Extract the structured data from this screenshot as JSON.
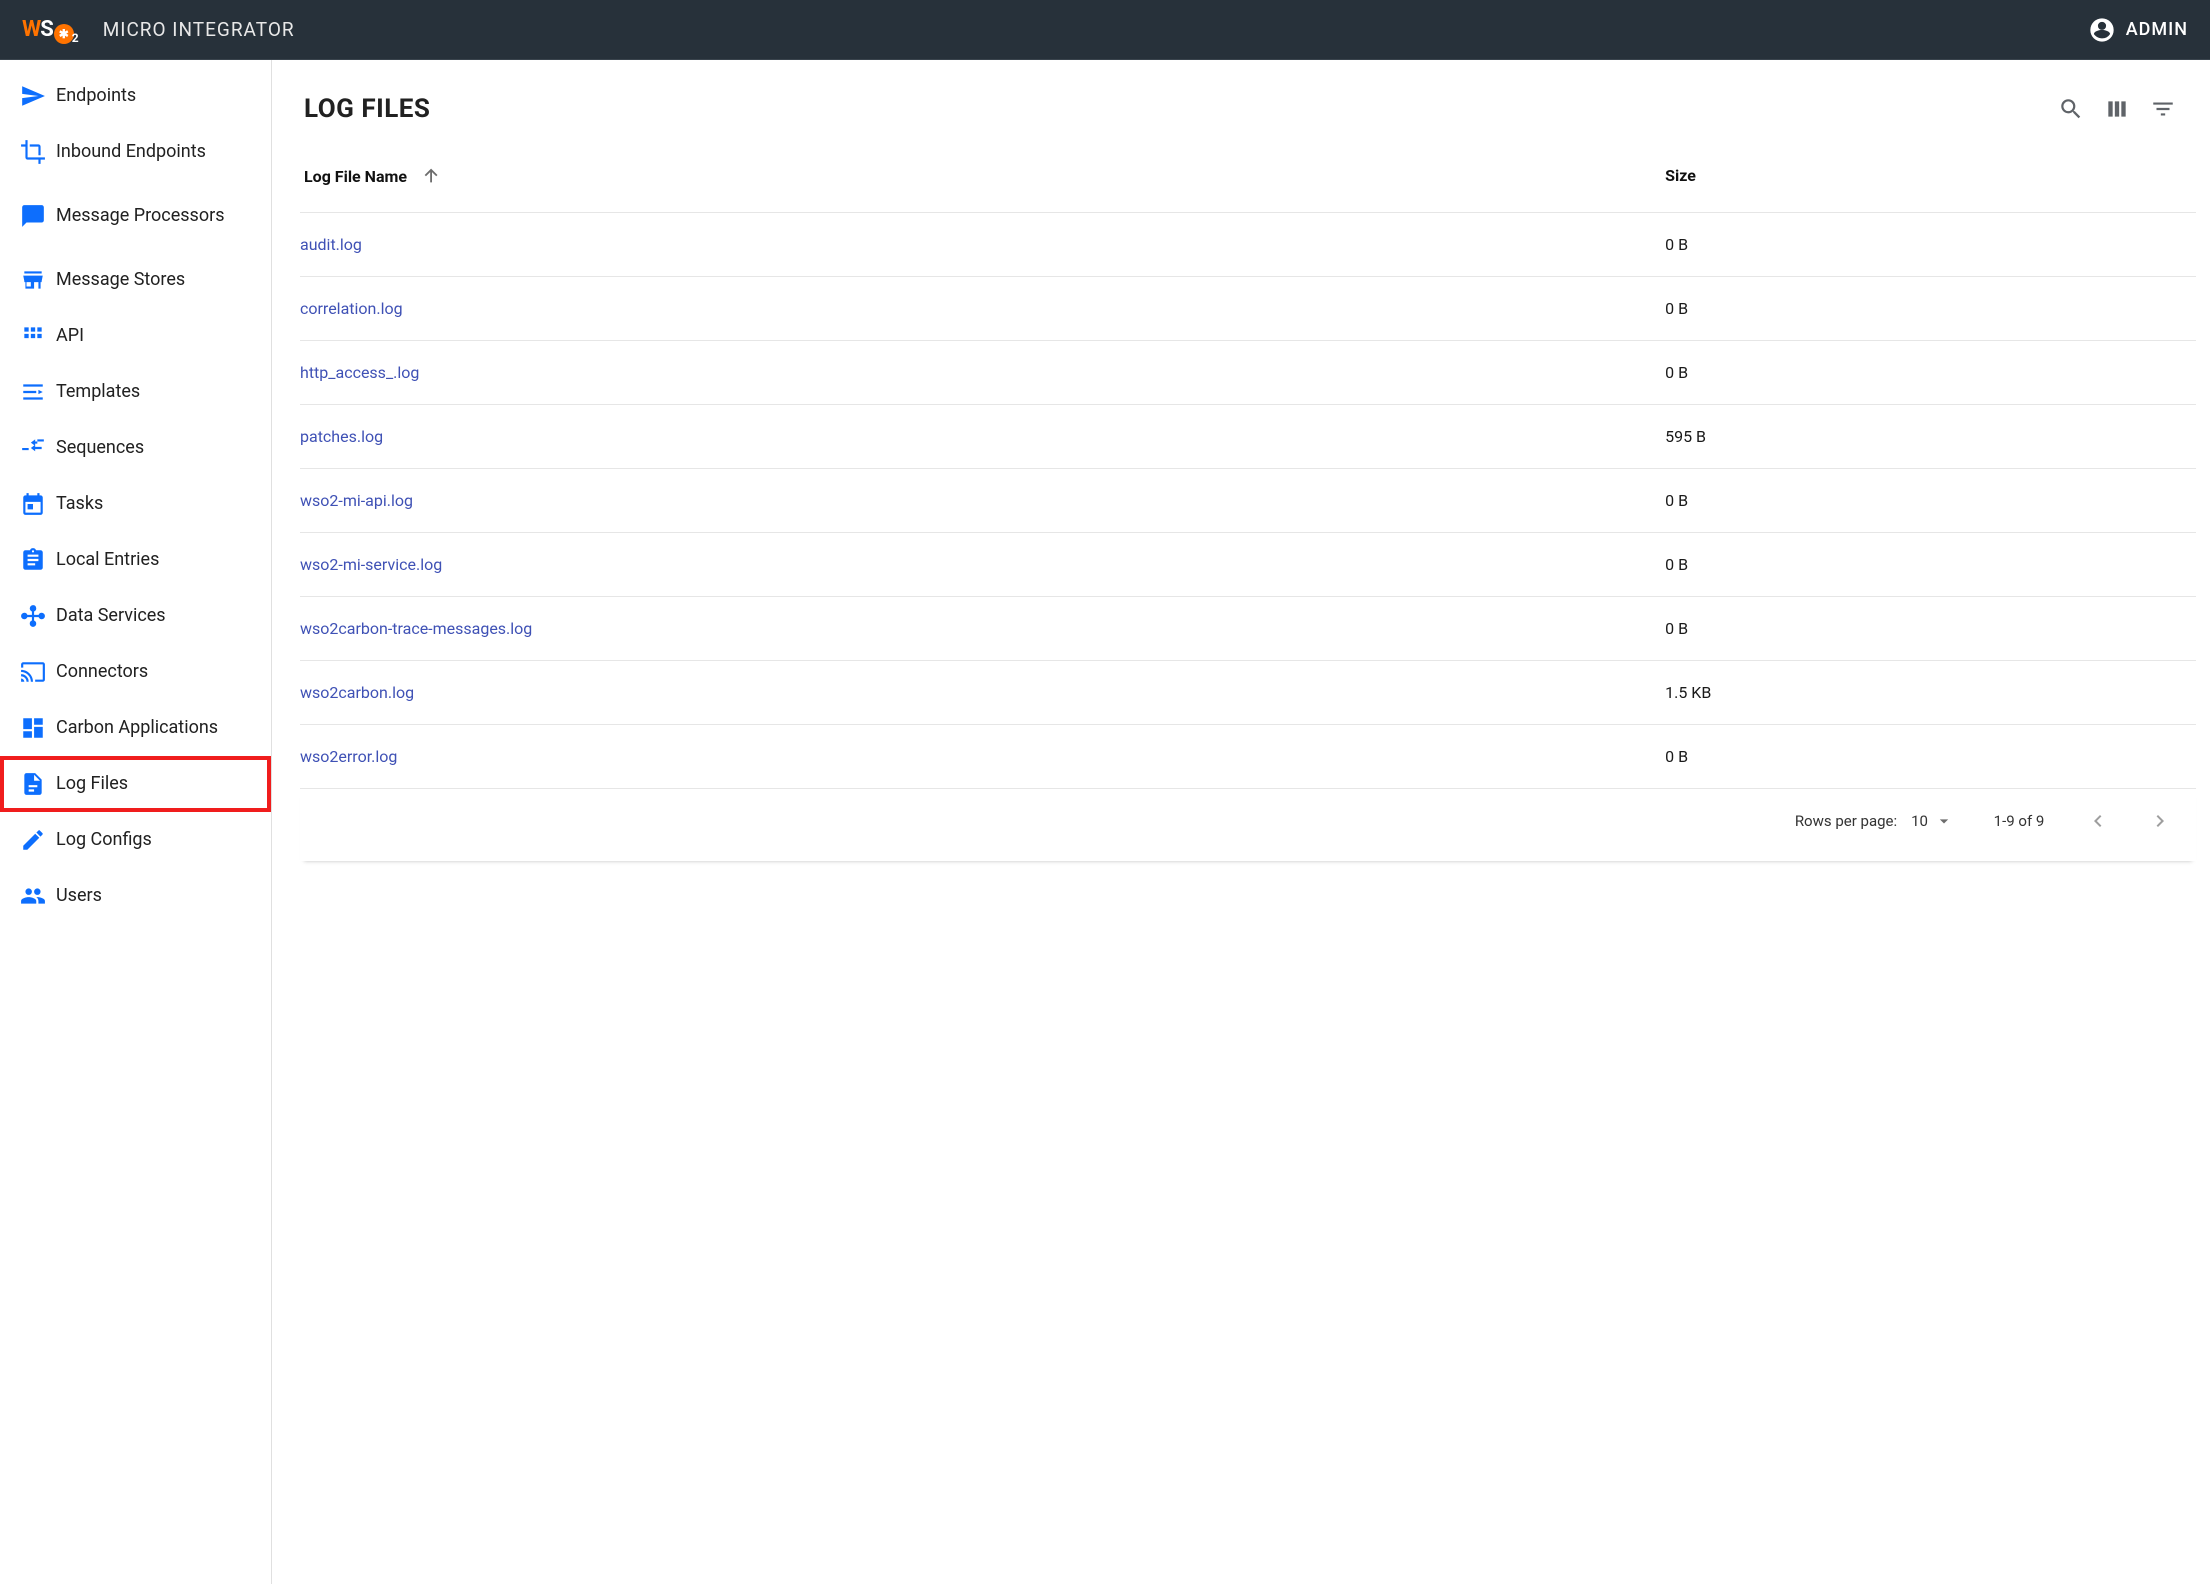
{
  "header": {
    "app_title": "MICRO INTEGRATOR",
    "user_label": "ADMIN"
  },
  "sidebar": {
    "items": [
      {
        "label": "Endpoints",
        "icon": "send",
        "active": false
      },
      {
        "label": "Inbound Endpoints",
        "icon": "crop",
        "active": false
      },
      {
        "label": "Message Processors",
        "icon": "message",
        "active": false,
        "tall": true
      },
      {
        "label": "Message Stores",
        "icon": "store",
        "active": false
      },
      {
        "label": "API",
        "icon": "grid",
        "active": false
      },
      {
        "label": "Templates",
        "icon": "template",
        "active": false
      },
      {
        "label": "Sequences",
        "icon": "sequence",
        "active": false
      },
      {
        "label": "Tasks",
        "icon": "calendar",
        "active": false
      },
      {
        "label": "Local Entries",
        "icon": "clipboard",
        "active": false
      },
      {
        "label": "Data Services",
        "icon": "hub",
        "active": false
      },
      {
        "label": "Connectors",
        "icon": "cast",
        "active": false
      },
      {
        "label": "Carbon Applications",
        "icon": "dashboard",
        "active": false
      },
      {
        "label": "Log Files",
        "icon": "file",
        "active": true
      },
      {
        "label": "Log Configs",
        "icon": "pencil",
        "active": false
      },
      {
        "label": "Users",
        "icon": "people",
        "active": false
      }
    ]
  },
  "main": {
    "title": "LOG FILES",
    "columns": {
      "name": "Log File Name",
      "size": "Size"
    },
    "rows": [
      {
        "name": "audit.log",
        "size": "0 B"
      },
      {
        "name": "correlation.log",
        "size": "0 B"
      },
      {
        "name": "http_access_.log",
        "size": "0 B"
      },
      {
        "name": "patches.log",
        "size": "595 B"
      },
      {
        "name": "wso2-mi-api.log",
        "size": "0 B"
      },
      {
        "name": "wso2-mi-service.log",
        "size": "0 B"
      },
      {
        "name": "wso2carbon-trace-messages.log",
        "size": "0 B"
      },
      {
        "name": "wso2carbon.log",
        "size": "1.5 KB"
      },
      {
        "name": "wso2error.log",
        "size": "0 B"
      }
    ],
    "pagination": {
      "rows_per_page_label": "Rows per page:",
      "rows_per_page_value": "10",
      "range_label": "1-9 of 9"
    }
  }
}
